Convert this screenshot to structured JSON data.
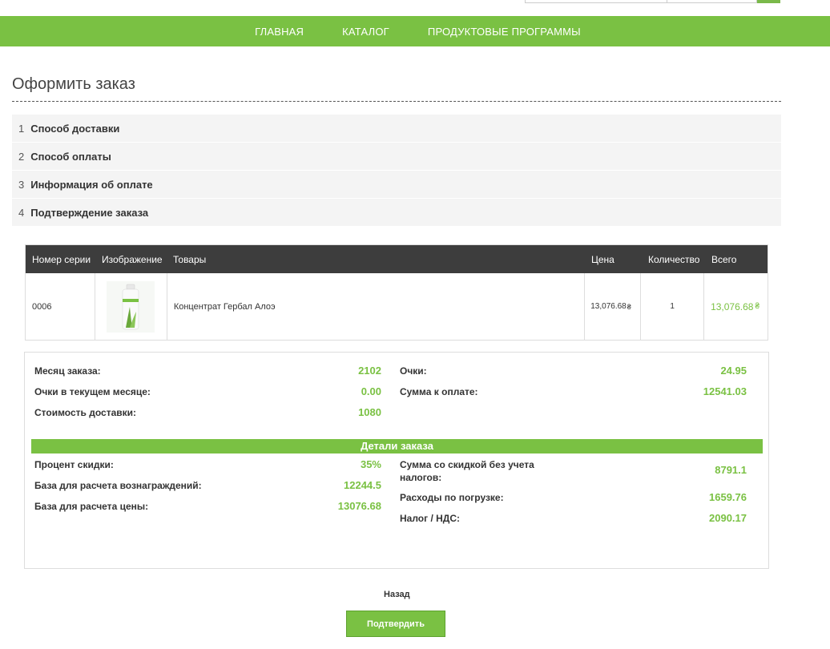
{
  "nav": {
    "items": [
      "ГЛАВНАЯ",
      "КАТАЛОГ",
      "ПРОДУКТОВЫЕ ПРОГРАММЫ"
    ]
  },
  "page": {
    "title": "Оформить заказ"
  },
  "steps": [
    {
      "num": "1",
      "label": "Способ доставки"
    },
    {
      "num": "2",
      "label": "Способ оплаты"
    },
    {
      "num": "3",
      "label": "Информация об оплате"
    },
    {
      "num": "4",
      "label": "Подтверждение заказа"
    }
  ],
  "cart": {
    "headers": {
      "serial": "Номер серии",
      "image": "Изображение",
      "product": "Товары",
      "price": "Цена",
      "qty": "Количество",
      "total": "Всего"
    },
    "row": {
      "serial": "0006",
      "product": "Концентрат Гербал Алоэ",
      "price": "13,076.68",
      "qty": "1",
      "total": "13,076.68"
    }
  },
  "summary": {
    "order_month_label": "Месяц заказа:",
    "order_month_value": "2102",
    "points_label": "Очки:",
    "points_value": "24.95",
    "month_points_label": "Очки в текущем месяце:",
    "month_points_value": "0.00",
    "payable_label": "Сумма к оплате:",
    "payable_value": "12541.03",
    "shipping_label": "Стоимость доставки:",
    "shipping_value": "1080"
  },
  "details": {
    "title": "Детали заказа",
    "discount_label": "Процент скидки:",
    "discount_value": "35%",
    "reward_base_label": "База для расчета вознаграждений:",
    "reward_base_value": "12244.5",
    "price_base_label": "База для расчета цены:",
    "price_base_value": "13076.68",
    "discounted_label": "Сумма со скидкой без учета налогов:",
    "discounted_value": "8791.1",
    "loading_label": "Расходы по погрузке:",
    "loading_value": "1659.76",
    "tax_label": "Налог / НДС:",
    "tax_value": "2090.17"
  },
  "actions": {
    "back": "Назад",
    "confirm": "Подтвердить"
  },
  "colors": {
    "accent": "#7ac143",
    "header_dark": "#3d3d3d"
  }
}
